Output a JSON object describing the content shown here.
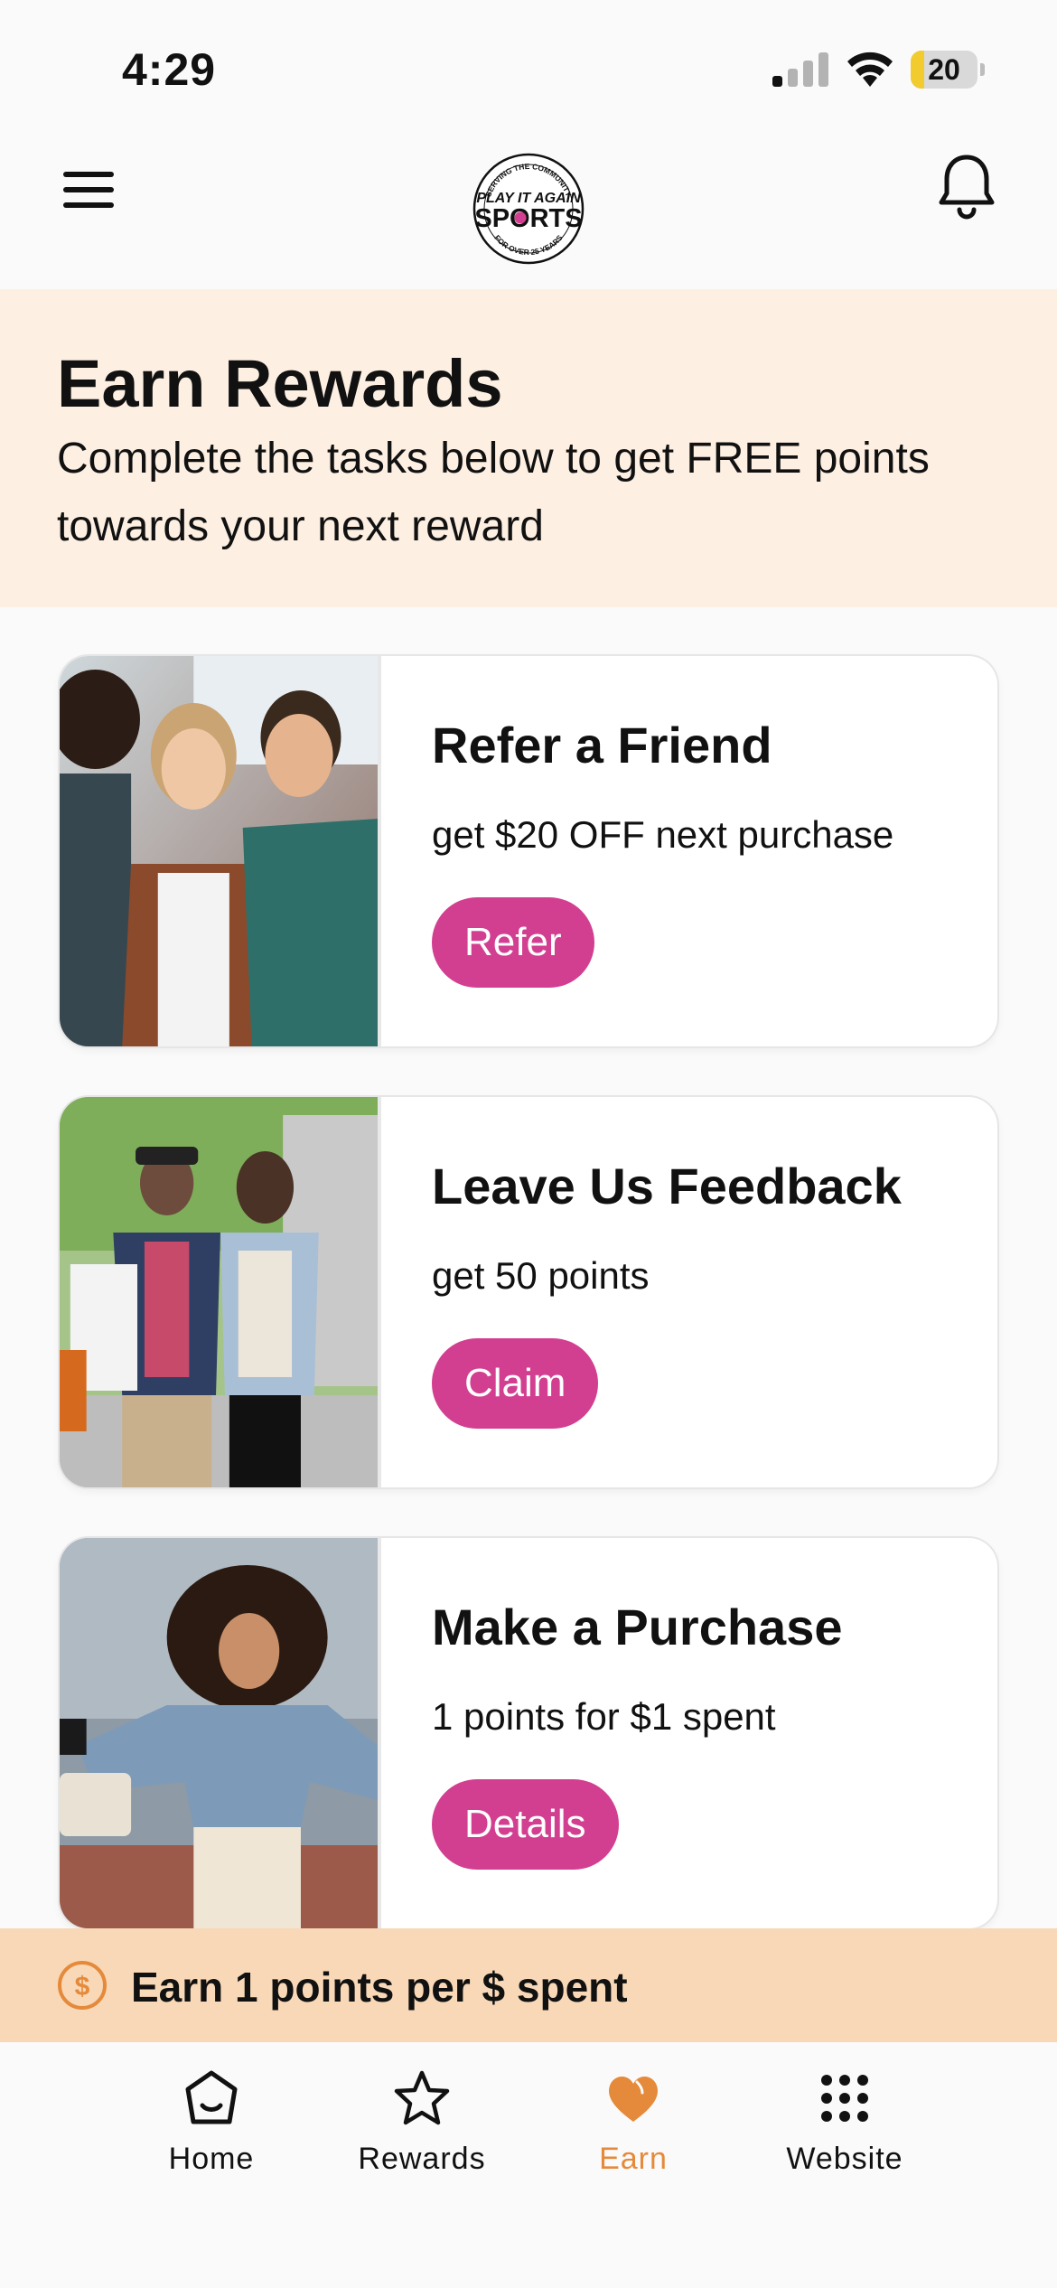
{
  "status_bar": {
    "time": "4:29",
    "battery_level": "20",
    "battery_fraction": 0.2
  },
  "header": {
    "logo_text_top": "SERVING THE COMMUNITY",
    "logo_line_1": "PLAY IT AGAIN",
    "logo_line_2": "SPORTS",
    "logo_text_bottom": "FOR OVER 25 YEARS",
    "menu_icon": "hamburger-menu-icon",
    "notification_icon": "bell-icon"
  },
  "hero": {
    "title": "Earn Rewards",
    "subtitle": "Complete the tasks below to get FREE points towards your next reward"
  },
  "cards": [
    {
      "title": "Refer a Friend",
      "description": "get $20 OFF next purchase",
      "button": "Refer"
    },
    {
      "title": "Leave Us Feedback",
      "description": "get 50 points",
      "button": "Claim"
    },
    {
      "title": "Make a Purchase",
      "description": "1 points for $1 spent",
      "button": "Details"
    }
  ],
  "earn_banner": {
    "text": "Earn 1 points per $ spent",
    "icon": "dollar-coin-icon"
  },
  "tabs": [
    {
      "label": "Home",
      "icon": "home-icon",
      "active": false
    },
    {
      "label": "Rewards",
      "icon": "star-icon",
      "active": false
    },
    {
      "label": "Earn",
      "icon": "heart-icon",
      "active": true
    },
    {
      "label": "Website",
      "icon": "grid-icon",
      "active": false
    }
  ],
  "colors": {
    "accent_pink": "#d23f91",
    "accent_orange": "#e58a3a",
    "hero_bg": "#fdefe2",
    "banner_bg": "#f8d8b7"
  }
}
